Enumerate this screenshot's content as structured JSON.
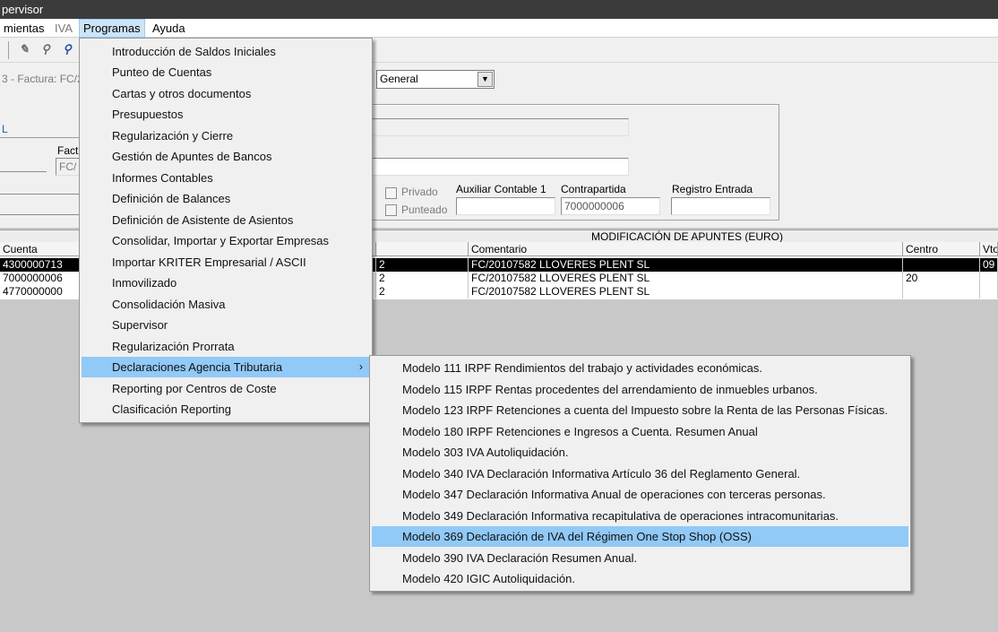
{
  "window": {
    "title": "pervisor"
  },
  "menubar": {
    "items": [
      {
        "label": "mientas"
      },
      {
        "label": "IVA"
      },
      {
        "label": "Programas"
      },
      {
        "label": "Ayuda"
      }
    ]
  },
  "toolbar": {
    "icons": [
      "edit-doc-icon",
      "binoculars-icon",
      "search-doc-icon"
    ]
  },
  "form": {
    "invoice_label": "3 - Factura: FC/2",
    "view_combo_value": "General",
    "left_link": "L",
    "fact_label": "Fact",
    "fact_value": "FC/",
    "privado_label": "Privado",
    "punteado_label": "Punteado",
    "auxiliar_label": "Auxiliar Contable 1",
    "auxiliar_value": "",
    "contrapartida_label": "Contrapartida",
    "contrapartida_value": "7000000006",
    "registro_label": "Registro  Entrada",
    "registro_value": ""
  },
  "grid": {
    "title": "MODIFICACIÓN DE APUNTES (EURO)",
    "headers": {
      "cuenta": "Cuenta",
      "comentario": "Comentario",
      "centro": "Centro",
      "vto": "Vto"
    },
    "rows": [
      {
        "cuenta": "4300000713",
        "mid": "2",
        "comentario": "FC/20107582 LLOVERES PLENT  SL",
        "centro": "",
        "vto": "09"
      },
      {
        "cuenta": "7000000006",
        "mid": "2",
        "comentario": "FC/20107582 LLOVERES PLENT  SL",
        "centro": "20",
        "vto": ""
      },
      {
        "cuenta": "4770000000",
        "mid": "2",
        "comentario": "FC/20107582 LLOVERES PLENT  SL",
        "centro": "",
        "vto": ""
      }
    ]
  },
  "programas_menu": {
    "items": [
      {
        "label": "Introducción de Saldos Iniciales"
      },
      {
        "label": "Punteo de Cuentas"
      },
      {
        "label": "Cartas y otros documentos"
      },
      {
        "label": "Presupuestos"
      },
      {
        "label": "Regularización y Cierre"
      },
      {
        "label": "Gestión de Apuntes de Bancos"
      },
      {
        "label": "Informes Contables"
      },
      {
        "label": "Definición de Balances"
      },
      {
        "label": "Definición de Asistente de Asientos"
      },
      {
        "label": "Consolidar, Importar y Exportar Empresas"
      },
      {
        "label": "Importar KRITER Empresarial / ASCII"
      },
      {
        "label": "Inmovilizado"
      },
      {
        "label": "Consolidación Masiva"
      },
      {
        "label": "Supervisor"
      },
      {
        "label": "Regularización Prorrata"
      },
      {
        "label": "Declaraciones Agencia Tributaria"
      },
      {
        "label": "Reporting por Centros de Coste"
      },
      {
        "label": "Clasificación Reporting"
      }
    ],
    "submenu_arrow": "›"
  },
  "declaraciones_submenu": {
    "items": [
      {
        "label": "Modelo 111 IRPF Rendimientos del trabajo y actividades económicas."
      },
      {
        "label": "Modelo 115 IRPF Rentas procedentes del arrendamiento de inmuebles urbanos."
      },
      {
        "label": "Modelo 123 IRPF Retenciones a cuenta del Impuesto sobre la Renta de las Personas Físicas."
      },
      {
        "label": "Modelo 180 IRPF Retenciones e Ingresos a Cuenta. Resumen Anual"
      },
      {
        "label": "Modelo 303 IVA Autoliquidación."
      },
      {
        "label": "Modelo 340 IVA Declaración Informativa Artículo 36 del Reglamento General."
      },
      {
        "label": "Modelo 347 Declaración Informativa Anual de operaciones con terceras personas."
      },
      {
        "label": "Modelo 349 Declaración Informativa recapitulativa de operaciones intracomunitarias."
      },
      {
        "label": "Modelo 369 Declaración de IVA del Régimen One Stop Shop (OSS)"
      },
      {
        "label": "Modelo 390 IVA Declaración Resumen Anual."
      },
      {
        "label": "Modelo 420 IGIC Autoliquidación."
      }
    ]
  }
}
